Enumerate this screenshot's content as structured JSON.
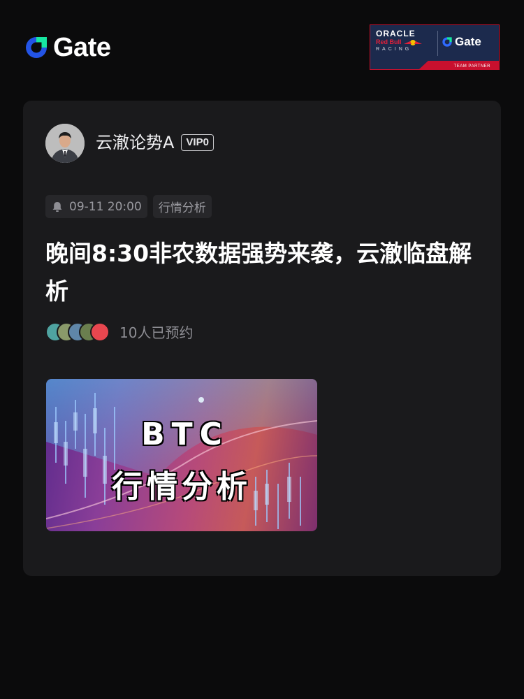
{
  "brand": {
    "logo_text": "Gate",
    "partner": {
      "oracle": "ORACLE",
      "redbull": "Red Bull",
      "racing": "RACING",
      "gate": "Gate",
      "team_partner": "TEAM PARTNER"
    }
  },
  "post": {
    "author": {
      "name": "云澈论势A",
      "vip": "VIP0"
    },
    "tags": {
      "time": "09-11 20:00",
      "category": "行情分析"
    },
    "title": "晚间8:30非农数据强势来袭，云澈临盘解析",
    "reservations": "10人已预约",
    "thumbnail": {
      "line1": "BTC",
      "line2": "行情分析"
    }
  },
  "colors": {
    "background": "#0b0b0c",
    "card": "#1a1a1c",
    "brand_blue": "#2354e6",
    "brand_green": "#17e6a1",
    "tag_bg": "#27272a"
  }
}
